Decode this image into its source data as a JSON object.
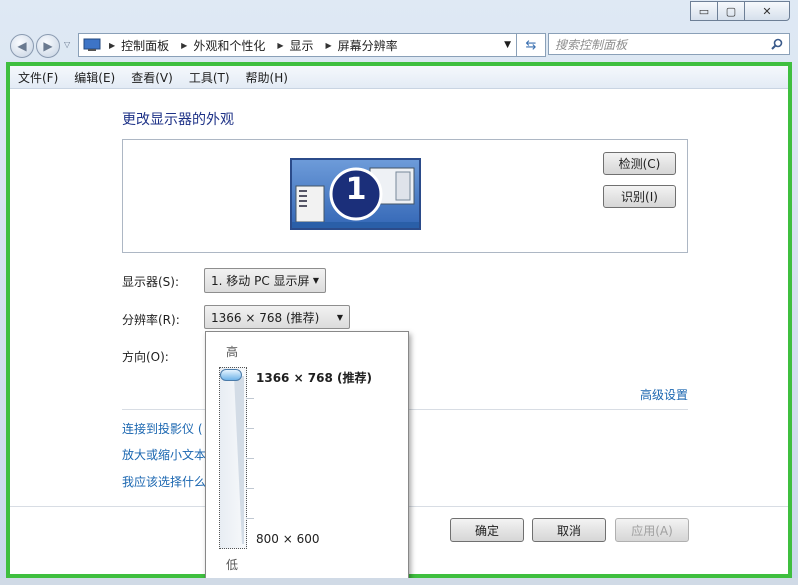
{
  "window": {
    "minimize": "▭",
    "maximize": "▢",
    "close": "✕"
  },
  "nav": {
    "back": "◀",
    "forward": "▶",
    "breadcrumbs": [
      "控制面板",
      "外观和个性化",
      "显示",
      "屏幕分辨率"
    ],
    "search_placeholder": "搜索控制面板"
  },
  "menu": [
    "文件(F)",
    "编辑(E)",
    "查看(V)",
    "工具(T)",
    "帮助(H)"
  ],
  "page": {
    "title": "更改显示器的外观",
    "monitor_number": "1",
    "detect_button": "检测(C)",
    "identify_button": "识别(I)",
    "display_label": "显示器(S):",
    "display_value": "1. 移动 PC 显示屏",
    "resolution_label": "分辨率(R):",
    "resolution_value": "1366 × 768 (推荐)",
    "orientation_label": "方向(O):",
    "advanced_link": "高级设置",
    "links": [
      "连接到投影仪 (",
      "放大或缩小文本",
      "我应该选择什么"
    ],
    "ok_button": "确定",
    "cancel_button": "取消",
    "apply_button": "应用(A)"
  },
  "resolution_popup": {
    "high_label": "高",
    "low_label": "低",
    "top_option": "1366 × 768 (推荐)",
    "bottom_option": "800 × 600",
    "slider_level": 1.0
  }
}
